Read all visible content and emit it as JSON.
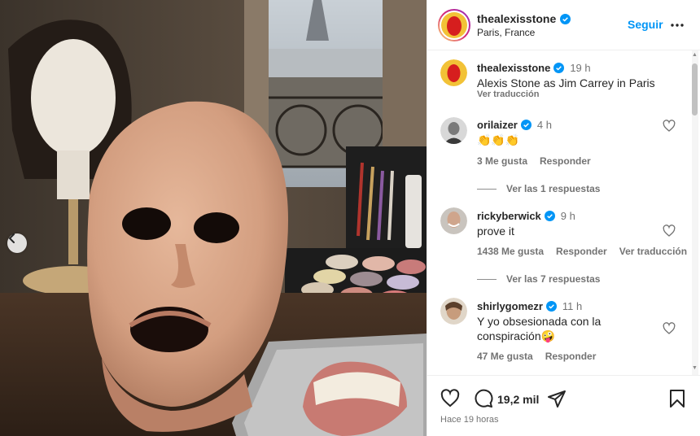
{
  "post": {
    "author": {
      "username": "thealexisstone",
      "location": "Paris, France"
    },
    "follow_label": "Seguir",
    "caption": {
      "username": "thealexisstone",
      "time": "19 h",
      "text": "Alexis Stone as Jim Carrey in Paris",
      "translate": "Ver traducción"
    }
  },
  "comments": [
    {
      "username": "orilaizer",
      "time": "4 h",
      "text": "👏👏👏",
      "likes": "3 Me gusta",
      "reply": "Responder",
      "replies": "Ver las 1 respuestas"
    },
    {
      "username": "rickyberwick",
      "time": "9 h",
      "text": "prove it",
      "likes": "1438 Me gusta",
      "reply": "Responder",
      "translate": "Ver traducción",
      "replies": "Ver las 7 respuestas"
    },
    {
      "username": "shirlygomezr",
      "time": "11 h",
      "text_line1": "Y yo obsesionada con la",
      "text_line2": "conspiración🤪",
      "likes": "47 Me gusta",
      "reply": "Responder"
    }
  ],
  "actions": {
    "comment_count": "19,2 mil",
    "posted": "Hace 19 horas"
  },
  "colors": {
    "accent": "#0095f6",
    "verified": "#0095f6",
    "muted": "#737373"
  },
  "icons": [
    "chevron-left-icon",
    "more-icon",
    "verified-icon",
    "heart-icon",
    "comment-icon",
    "share-icon",
    "bookmark-icon"
  ]
}
